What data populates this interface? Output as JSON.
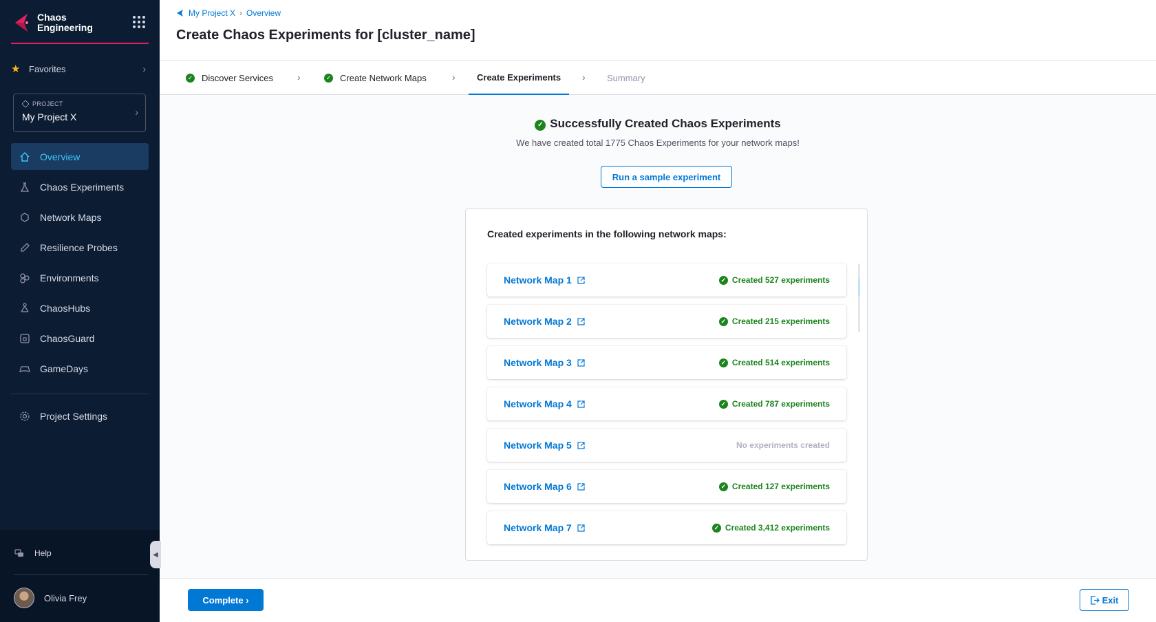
{
  "app": {
    "name": "Chaos\nEngineering",
    "accent": "#e4215e",
    "primary": "#0278d5",
    "success": "#1b841d"
  },
  "sidebar": {
    "favorites_label": "Favorites",
    "project_tag": "PROJECT",
    "project_name": "My Project X",
    "items": [
      {
        "label": "Overview",
        "icon": "home-icon"
      },
      {
        "label": "Chaos Experiments",
        "icon": "flask-icon"
      },
      {
        "label": "Network Maps",
        "icon": "hexagon-icon"
      },
      {
        "label": "Resilience Probes",
        "icon": "probe-icon"
      },
      {
        "label": "Environments",
        "icon": "environments-icon"
      },
      {
        "label": "ChaosHubs",
        "icon": "hub-icon"
      },
      {
        "label": "ChaosGuard",
        "icon": "guard-icon"
      },
      {
        "label": "GameDays",
        "icon": "gamepad-icon"
      }
    ],
    "settings_label": "Project Settings",
    "help_label": "Help",
    "user_name": "Olivia Frey"
  },
  "header": {
    "breadcrumb": [
      "My Project X",
      "Overview"
    ],
    "title": "Create Chaos Experiments for [cluster_name]"
  },
  "stepper": {
    "steps": [
      {
        "label": "Discover Services",
        "state": "done"
      },
      {
        "label": "Create Network Maps",
        "state": "done"
      },
      {
        "label": "Create Experiments",
        "state": "active"
      },
      {
        "label": "Summary",
        "state": "disabled"
      }
    ]
  },
  "main": {
    "success_title": "Successfully Created Chaos Experiments",
    "success_sub": "We have created total 1775 Chaos Experiments for your network maps!",
    "run_button": "Run a sample experiment",
    "maps_heading": "Created experiments in the following network maps:",
    "maps": [
      {
        "name": "Network Map 1",
        "status": "Created 527 experiments",
        "ok": true
      },
      {
        "name": "Network Map 2",
        "status": "Created 215 experiments",
        "ok": true
      },
      {
        "name": "Network Map 3",
        "status": "Created 514 experiments",
        "ok": true
      },
      {
        "name": "Network Map 4",
        "status": "Created 787 experiments",
        "ok": true
      },
      {
        "name": "Network Map 5",
        "status": "No experiments created",
        "ok": false
      },
      {
        "name": "Network Map 6",
        "status": "Created 127 experiments",
        "ok": true
      },
      {
        "name": "Network Map 7",
        "status": "Created 3,412 experiments",
        "ok": true
      }
    ]
  },
  "footer": {
    "complete_label": "Complete",
    "exit_label": "Exit"
  }
}
